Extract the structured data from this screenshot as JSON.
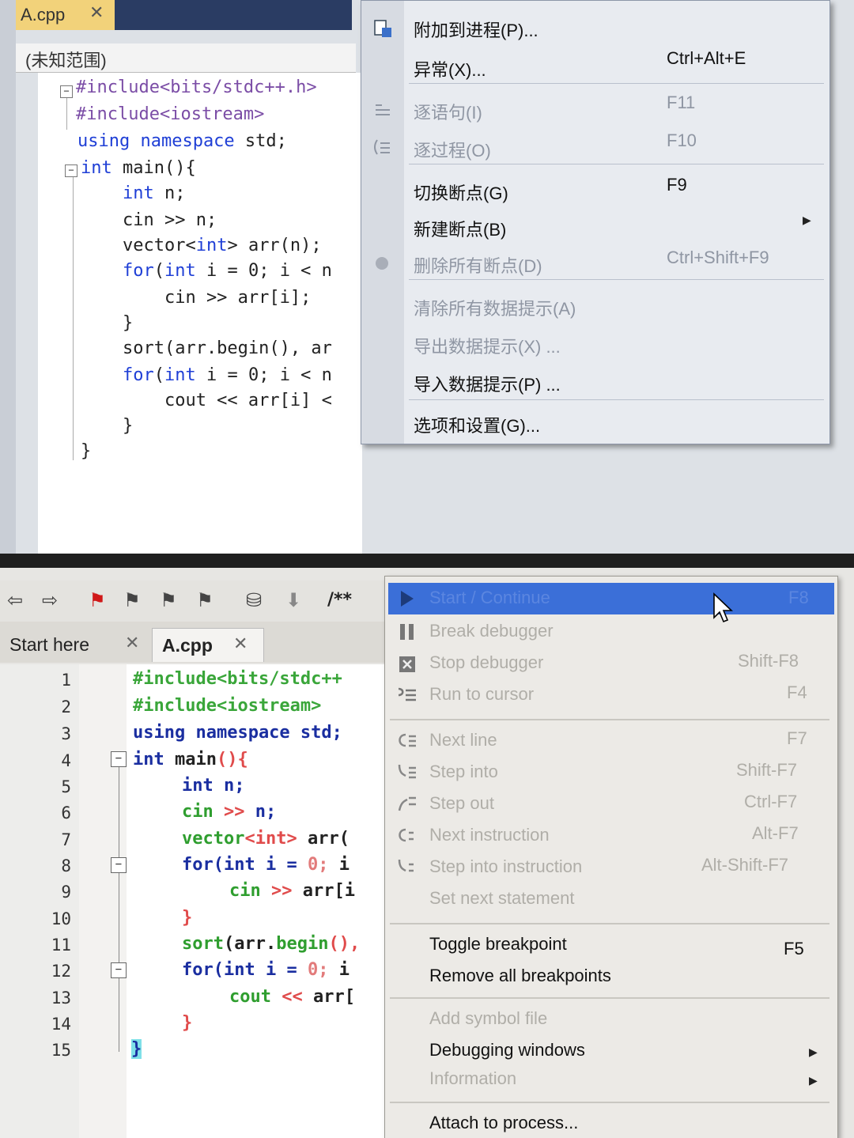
{
  "top_window": {
    "tab_title": "A.cpp",
    "tab_close": "✕",
    "scope": "(未知范围)",
    "code_lines": [
      "#include<bits/stdc++.h>",
      "#include<iostream>",
      "using namespace std;",
      "int main(){",
      "    int n;",
      "    cin >> n;",
      "    vector<int> arr(n);",
      "    for(int i = 0; i < n",
      "        cin >> arr[i];",
      "    }",
      "    sort(arr.begin(), ar",
      "    for(int i = 0; i < n",
      "        cout << arr[i] <",
      "    }",
      "}"
    ],
    "menu": [
      {
        "label": "附加到进程(P)...",
        "shortcut": "",
        "disabled": false
      },
      {
        "label": "异常(X)...",
        "shortcut": "Ctrl+Alt+E",
        "disabled": false
      },
      {
        "label": "逐语句(I)",
        "shortcut": "F11",
        "disabled": true
      },
      {
        "label": "逐过程(O)",
        "shortcut": "F10",
        "disabled": true
      },
      {
        "label": "切换断点(G)",
        "shortcut": "F9",
        "disabled": false
      },
      {
        "label": "新建断点(B)",
        "shortcut": "",
        "disabled": false,
        "submenu": true
      },
      {
        "label": "删除所有断点(D)",
        "shortcut": "Ctrl+Shift+F9",
        "disabled": true
      },
      {
        "label": "清除所有数据提示(A)",
        "shortcut": "",
        "disabled": true
      },
      {
        "label": "导出数据提示(X) ...",
        "shortcut": "",
        "disabled": true
      },
      {
        "label": "导入数据提示(P) ...",
        "shortcut": "",
        "disabled": false
      },
      {
        "label": "选项和设置(G)...",
        "shortcut": "",
        "disabled": false
      }
    ]
  },
  "bottom_window": {
    "toolbar_comment_label": "/**",
    "tabs": [
      {
        "label": "Start here",
        "close": "✕"
      },
      {
        "label": "A.cpp",
        "close": "✕"
      }
    ],
    "line_numbers": [
      "1",
      "2",
      "3",
      "4",
      "5",
      "6",
      "7",
      "8",
      "9",
      "10",
      "11",
      "12",
      "13",
      "14",
      "15"
    ],
    "code": {
      "l1": "#include<bits/stdc++",
      "l2": "#include<iostream>",
      "l3_a": "using namespace ",
      "l3_b": "std;",
      "l4_a": "int ",
      "l4_b": "main",
      "l4_c": "(){",
      "l5_a": "int ",
      "l5_b": "n;",
      "l6_a": "cin ",
      "l6_b": ">> ",
      "l6_c": "n;",
      "l7_a": "vector",
      "l7_b": "<int> ",
      "l7_c": "arr(",
      "l8_a": "for",
      "l8_b": "(int ",
      "l8_c": "i = ",
      "l8_d": "0;",
      "l8_e": " i",
      "l9_a": "cin ",
      "l9_b": ">> ",
      "l9_c": "arr[i",
      "l10": "}",
      "l11_a": "sort",
      "l11_b": "(arr.",
      "l11_c": "begin",
      "l11_d": "(),",
      "l12_a": "for",
      "l12_b": "(int ",
      "l12_c": "i = ",
      "l12_d": "0;",
      "l12_e": " i",
      "l13_a": "cout ",
      "l13_b": "<< ",
      "l13_c": "arr[",
      "l14": "}",
      "l15": "}"
    },
    "menu": [
      {
        "label": "Start / Continue",
        "shortcut": "F8",
        "disabled": false,
        "highlighted": true
      },
      {
        "label": "Break debugger",
        "shortcut": "",
        "disabled": true
      },
      {
        "label": "Stop debugger",
        "shortcut": "Shift-F8",
        "disabled": true
      },
      {
        "label": "Run to cursor",
        "shortcut": "F4",
        "disabled": true
      },
      {
        "label": "Next line",
        "shortcut": "F7",
        "disabled": true
      },
      {
        "label": "Step into",
        "shortcut": "Shift-F7",
        "disabled": true
      },
      {
        "label": "Step out",
        "shortcut": "Ctrl-F7",
        "disabled": true
      },
      {
        "label": "Next instruction",
        "shortcut": "Alt-F7",
        "disabled": true
      },
      {
        "label": "Step into instruction",
        "shortcut": "Alt-Shift-F7",
        "disabled": true
      },
      {
        "label": "Set next statement",
        "shortcut": "",
        "disabled": true
      },
      {
        "label": "Toggle breakpoint",
        "shortcut": "F5",
        "disabled": false
      },
      {
        "label": "Remove all breakpoints",
        "shortcut": "",
        "disabled": false
      },
      {
        "label": "Add symbol file",
        "shortcut": "",
        "disabled": true
      },
      {
        "label": "Debugging windows",
        "shortcut": "",
        "disabled": false,
        "submenu": true
      },
      {
        "label": "Information",
        "shortcut": "",
        "disabled": true,
        "submenu": true
      },
      {
        "label": "Attach to process...",
        "shortcut": "",
        "disabled": false
      }
    ]
  }
}
